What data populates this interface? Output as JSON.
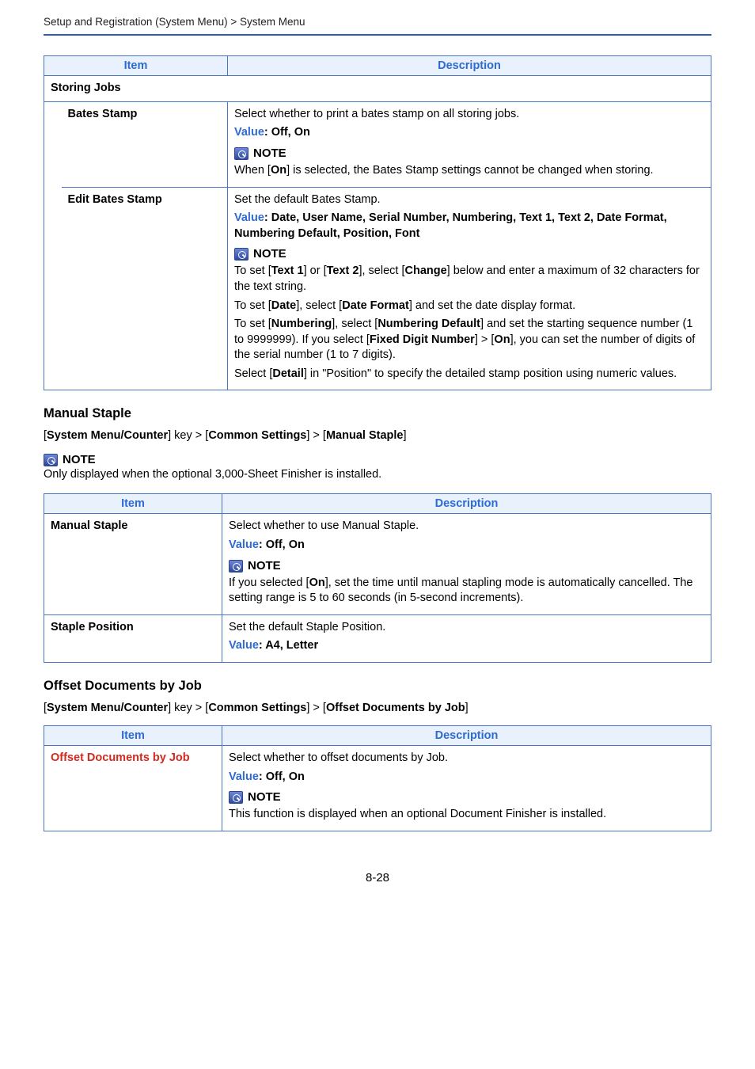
{
  "breadcrumb": "Setup and Registration (System Menu) > System Menu",
  "col": {
    "item": "Item",
    "desc": "Description"
  },
  "note_word": "NOTE",
  "t1": {
    "group": "Storing Jobs",
    "r1": {
      "item": "Bates Stamp",
      "line1": "Select whether to print a bates stamp on all storing jobs.",
      "valueLabel": "Value",
      "valueText": ": Off, On",
      "note_pre": "When [",
      "note_bold": "On",
      "note_post": "] is selected, the Bates Stamp settings cannot be changed when storing."
    },
    "r2": {
      "item": "Edit Bates Stamp",
      "line1": "Set the default Bates Stamp.",
      "valueLabel": "Value",
      "valueText": ": Date, User Name, Serial Number, Numbering, Text 1, Text 2, Date Format, Numbering Default, Position, Font",
      "n1_a": "To set [",
      "n1_b1": "Text 1",
      "n1_c": "] or [",
      "n1_b2": "Text 2",
      "n1_d": "], select [",
      "n1_b3": "Change",
      "n1_e": "] below and enter a maximum of 32 characters for the text string.",
      "n2_a": "To set [",
      "n2_b1": "Date",
      "n2_c": "], select [",
      "n2_b2": "Date Format",
      "n2_d": "] and set the date display format.",
      "n3_a": "To set [",
      "n3_b1": "Numbering",
      "n3_c": "], select [",
      "n3_b2": "Numbering Default",
      "n3_d": "] and set the starting sequence number (1 to 9999999). If you select [",
      "n3_b3": "Fixed Digit Number",
      "n3_e": "] > [",
      "n3_b4": "On",
      "n3_f": "], you can set the number of digits of the serial number (1 to 7 digits).",
      "n4_a": "Select [",
      "n4_b1": "Detail",
      "n4_c": "] in \"Position\" to specify the detailed stamp position using numeric values."
    }
  },
  "sec2": {
    "title": "Manual Staple",
    "path_a": "[",
    "path_b1": "System Menu/Counter",
    "path_c": "] key > [",
    "path_b2": "Common Settings",
    "path_d": "] > [",
    "path_b3": "Manual Staple",
    "path_e": "]",
    "topnote": "Only displayed when the optional 3,000-Sheet Finisher is installed.",
    "r1": {
      "item": "Manual Staple",
      "line1": "Select whether to use Manual Staple.",
      "valueLabel": "Value",
      "valueText": ": Off, On",
      "n_a": "If you selected [",
      "n_b": "On",
      "n_c": "], set the time until manual stapling mode is automatically cancelled. The setting range is 5 to 60 seconds (in 5-second increments)."
    },
    "r2": {
      "item": "Staple Position",
      "line1": "Set the default Staple Position.",
      "valueLabel": "Value",
      "valueText": ": A4, Letter"
    }
  },
  "sec3": {
    "title": "Offset Documents by Job",
    "path_a": "[",
    "path_b1": "System Menu/Counter",
    "path_c": "] key > [",
    "path_b2": "Common Settings",
    "path_d": "] > [",
    "path_b3": "Offset Documents by Job",
    "path_e": "]",
    "r1": {
      "item": "Offset Documents by Job",
      "line1": "Select whether to offset documents by Job.",
      "valueLabel": "Value",
      "valueText": ": Off, On",
      "note": "This function is displayed when an optional Document Finisher is installed."
    }
  },
  "pagenum": "8-28"
}
